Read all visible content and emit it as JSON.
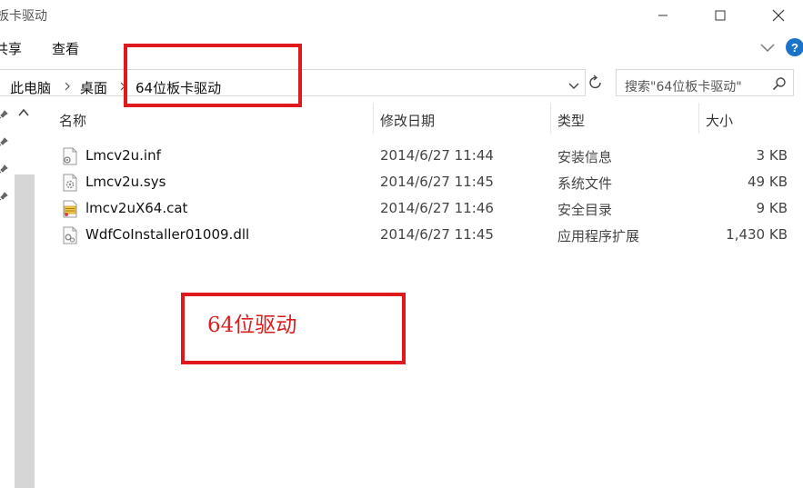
{
  "window": {
    "title": "板卡驱动"
  },
  "ribbon": {
    "tabs": [
      {
        "label": "共享"
      },
      {
        "label": "查看"
      }
    ],
    "help_label": "?"
  },
  "address_bar": {
    "breadcrumb": [
      "此电脑",
      "桌面",
      "64位板卡驱动"
    ]
  },
  "search": {
    "placeholder": "搜索\"64位板卡驱动\""
  },
  "columns": {
    "name": "名称",
    "date": "修改日期",
    "type": "类型",
    "size": "大小"
  },
  "files": [
    {
      "name": "Lmcv2u.inf",
      "date": "2014/6/27 11:44",
      "type": "安装信息",
      "size": "3 KB",
      "icon": "inf-file-icon"
    },
    {
      "name": "Lmcv2u.sys",
      "date": "2014/6/27 11:45",
      "type": "系统文件",
      "size": "49 KB",
      "icon": "sys-file-icon"
    },
    {
      "name": "lmcv2uX64.cat",
      "date": "2014/6/27 11:46",
      "type": "安全目录",
      "size": "9 KB",
      "icon": "cat-file-icon"
    },
    {
      "name": "WdfCoInstaller01009.dll",
      "date": "2014/6/27 11:45",
      "type": "应用程序扩展",
      "size": "1,430 KB",
      "icon": "dll-file-icon"
    }
  ],
  "annotation": {
    "label": "64位驱动",
    "color": "#e0191e"
  },
  "colors": {
    "accent": "#1a73c9",
    "annotation_red": "#e0191e"
  }
}
